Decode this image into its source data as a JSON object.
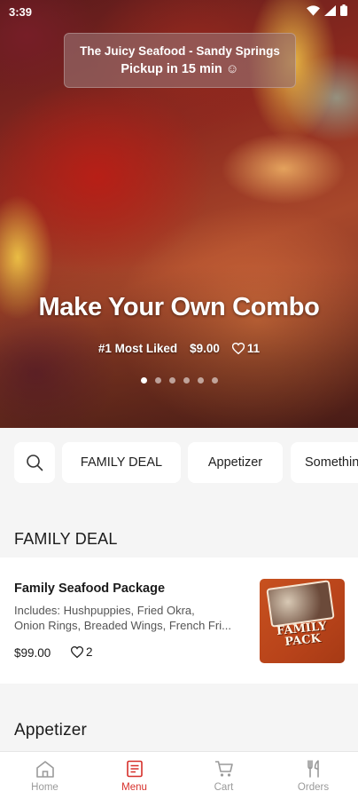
{
  "status_bar": {
    "time": "3:39"
  },
  "hero": {
    "store_name": "The Juicy Seafood - Sandy Springs",
    "pickup_eta": "Pickup in 15 min ☺",
    "title": "Make Your Own Combo",
    "badge": "#1 Most Liked",
    "price": "$9.00",
    "likes": "11",
    "carousel": {
      "total": 6,
      "active_index": 0
    }
  },
  "categories": [
    "FAMILY DEAL",
    "Appetizer",
    "Something"
  ],
  "sections": [
    {
      "title": "FAMILY DEAL",
      "items": [
        {
          "name": "Family Seafood Package",
          "desc_line1": "Includes: Hushpuppies, Fried Okra,",
          "desc_line2": "Onion Rings, Breaded Wings, French Fri...",
          "price": "$99.00",
          "likes": "2",
          "image_text": "FAMILY PACK"
        }
      ]
    },
    {
      "title": "Appetizer"
    }
  ],
  "nav": [
    {
      "label": "Home",
      "icon": "home-icon"
    },
    {
      "label": "Menu",
      "icon": "menu-icon",
      "active": true
    },
    {
      "label": "Cart",
      "icon": "cart-icon"
    },
    {
      "label": "Orders",
      "icon": "utensils-icon"
    }
  ],
  "colors": {
    "accent": "#d62f2a",
    "background": "#f5f5f5",
    "card": "#ffffff",
    "inactive": "#9a9a9a"
  }
}
